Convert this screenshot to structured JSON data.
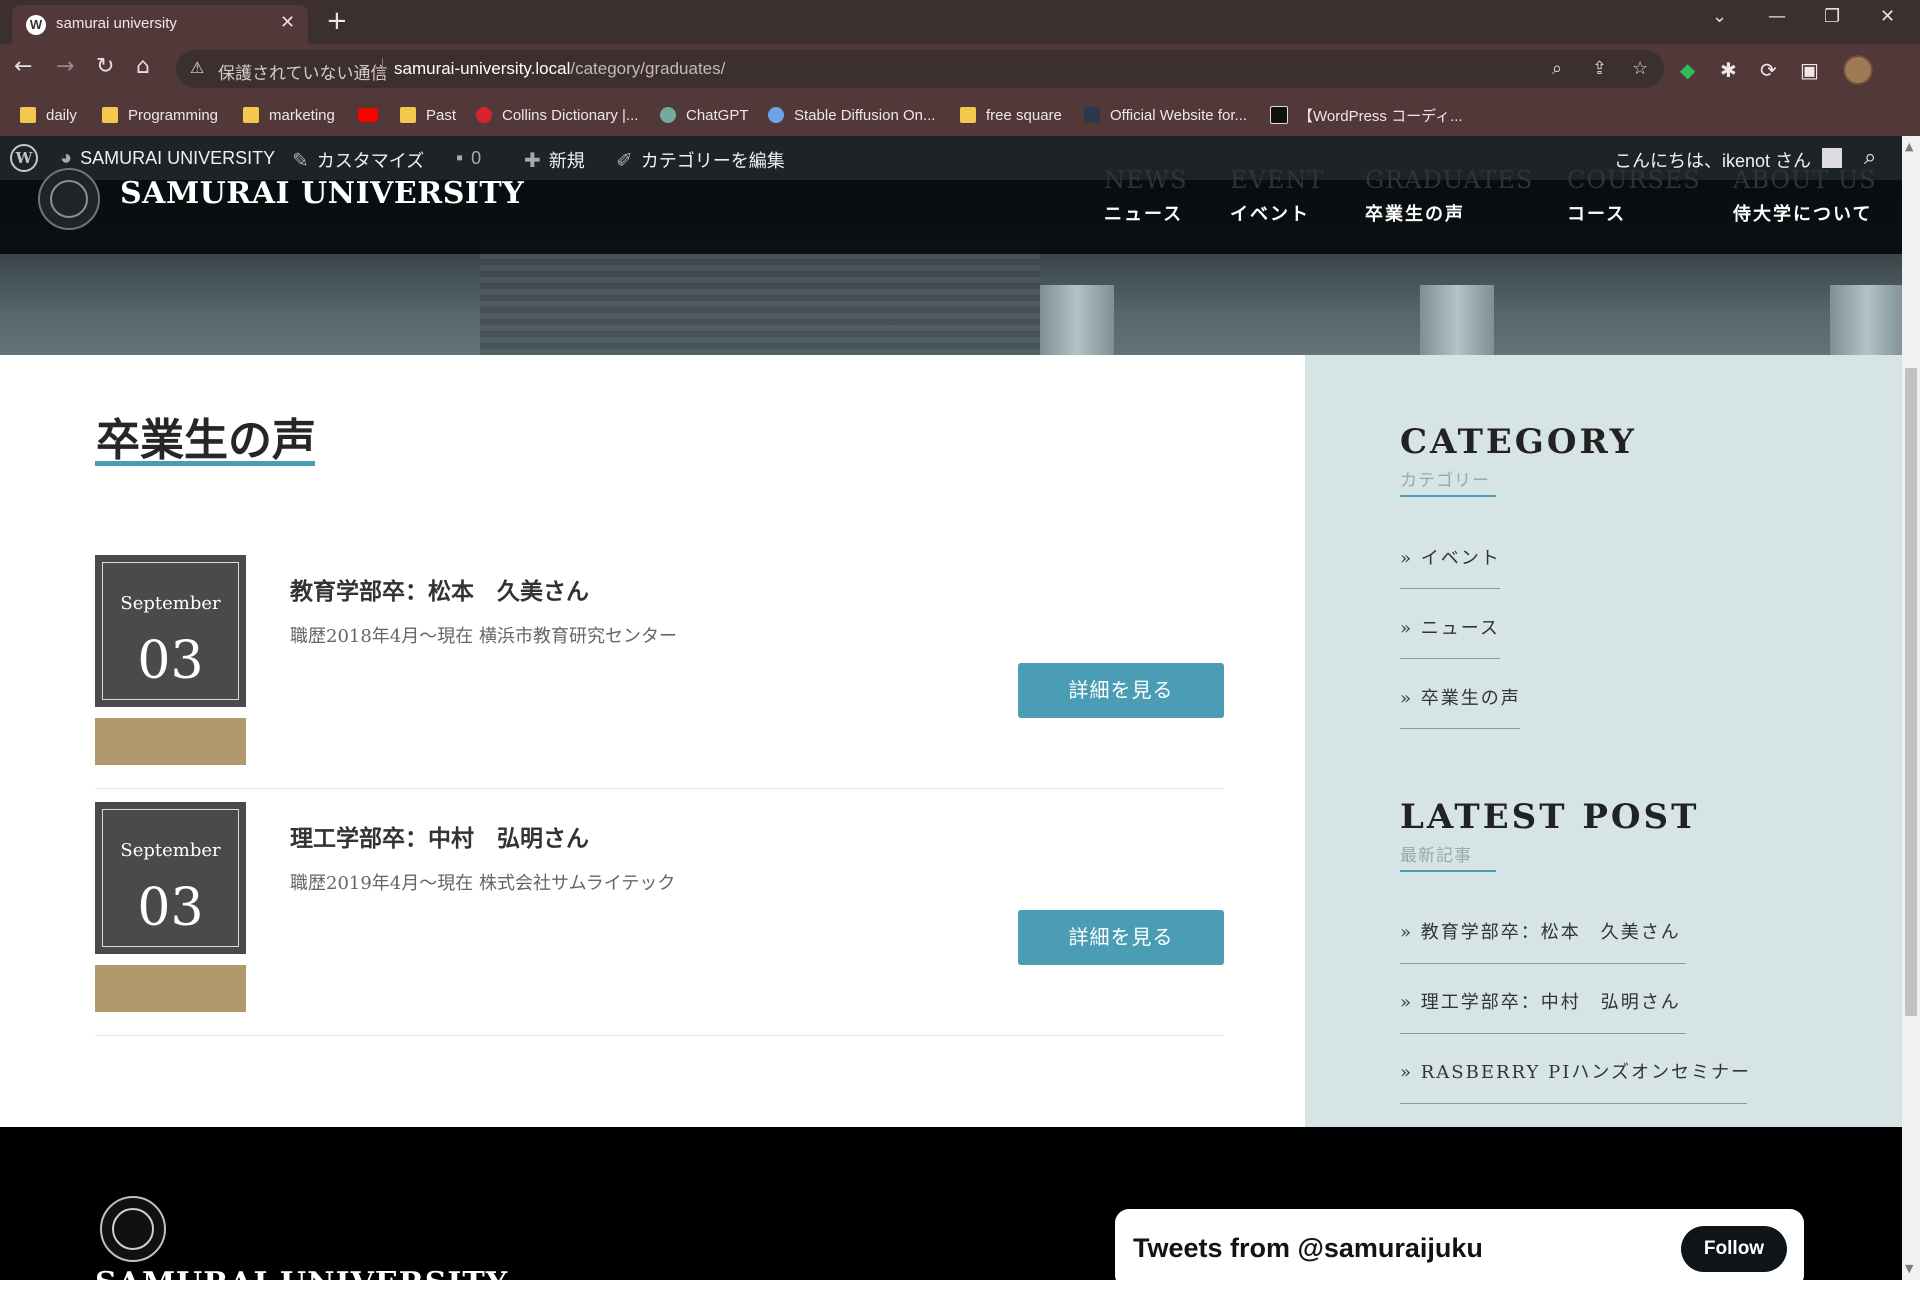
{
  "browser": {
    "tab_title": "samurai university",
    "tab_favicon": "W",
    "new_tab": "+",
    "close_tab": "✕",
    "window_controls": [
      "⌄",
      "—",
      "❐",
      "✕"
    ],
    "security_text": "保護されていない通信",
    "url_host": "samurai-university.local",
    "url_path": "/category/graduates/",
    "bookmarks": [
      "daily",
      "Programming",
      "marketing",
      "",
      "Past",
      "Collins Dictionary |...",
      "ChatGPT",
      "Stable Diffusion On...",
      "free square",
      "Official Website for...",
      "【WordPress コーディ..."
    ]
  },
  "adminbar": {
    "site": "SAMURAI UNIVERSITY",
    "customize": "カスタマイズ",
    "comments_count": "0",
    "new": "新規",
    "edit_category": "カテゴリーを編集",
    "greeting": "こんにちは、ikenot さん"
  },
  "site": {
    "name": "SAMURAI UNIVERSITY",
    "nav": [
      {
        "en": "NEWS",
        "jp": "ニュース"
      },
      {
        "en": "EVENT",
        "jp": "イベント"
      },
      {
        "en": "GRADUATES",
        "jp": "卒業生の声"
      },
      {
        "en": "COURSES",
        "jp": "コース"
      },
      {
        "en": "ABOUT US",
        "jp": "侍大学について"
      }
    ]
  },
  "main": {
    "page_title": "卒業生の声",
    "posts": [
      {
        "month": "September",
        "day": "03",
        "title": "教育学部卒：松本　久美さん",
        "excerpt": "職歴2018年4月〜現在 横浜市教育研究センター",
        "button": "詳細を見る"
      },
      {
        "month": "September",
        "day": "03",
        "title": "理工学部卒：中村　弘明さん",
        "excerpt": "職歴2019年4月〜現在 株式会社サムライテック",
        "button": "詳細を見る"
      }
    ]
  },
  "sidebar": {
    "category_heading": "CATEGORY",
    "category_sub": "カテゴリー",
    "categories": [
      "» イベント",
      "» ニュース",
      "» 卒業生の声"
    ],
    "latest_heading": "LATEST POST",
    "latest_sub": "最新記事",
    "latest": [
      "» 教育学部卒：松本　久美さん",
      "» 理工学部卒：中村　弘明さん",
      "» RASBERRY PIハンズオンセミナー"
    ]
  },
  "footer": {
    "name": "SAMURAI UNIVERSITY",
    "tweets_title": "Tweets from @samuraijuku",
    "follow": "Follow"
  },
  "colors": {
    "accent": "#4a9db5",
    "gold": "#b09a6b",
    "sidebar_bg": "#d6e4e6",
    "browser_frame": "#523838"
  }
}
